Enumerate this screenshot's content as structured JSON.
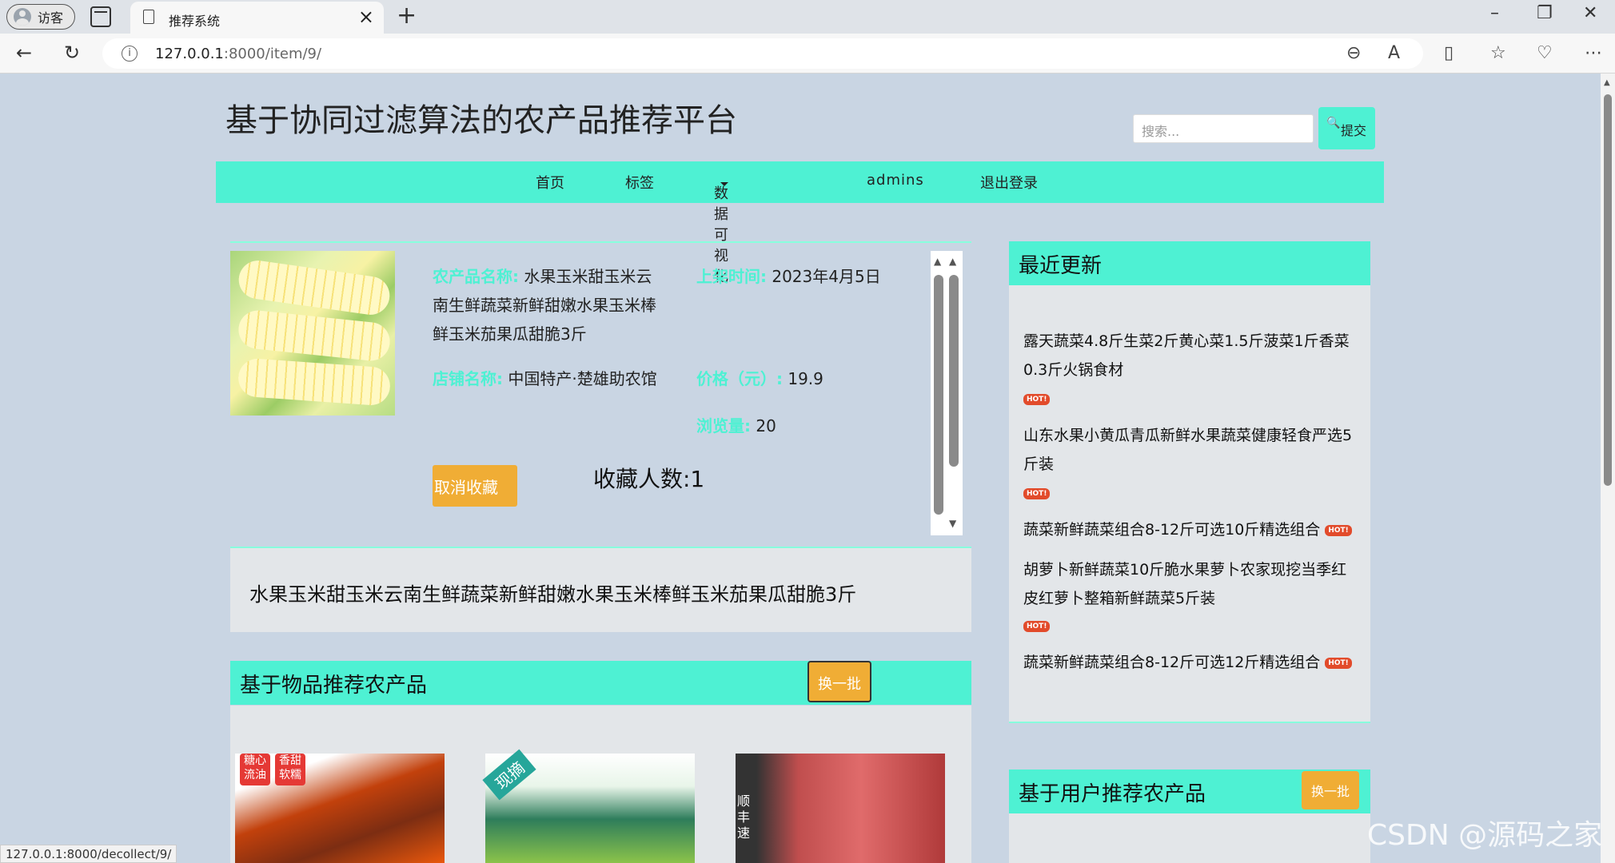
{
  "browser": {
    "profile_label": "访客",
    "tab_title": "推荐系统",
    "url_host": "127.0.0.1",
    "url_path": ":8000/item/9/",
    "status_url": "127.0.0.1:8000/decollect/9/"
  },
  "site": {
    "title": "基于协同过滤算法的农产品推荐平台",
    "search_placeholder": "搜索...",
    "submit_label": "提交"
  },
  "nav": {
    "items": [
      "首页",
      "标签",
      "数据可视化",
      "admins",
      "退出登录"
    ]
  },
  "product": {
    "name_label": "农产品名称:",
    "name": "水果玉米甜玉米云南生鲜蔬菜新鲜甜嫩水果玉米棒鲜玉米茄果瓜甜脆3斤",
    "date_label": "上架时间:",
    "date": "2023年4月5日",
    "shop_label": "店铺名称:",
    "shop": "中国特产·楚雄助农馆",
    "price_label": "价格（元）:",
    "price": "19.9",
    "views_label": "浏览量:",
    "views": "20",
    "unfavorite_label": "取消收藏",
    "favorite_count": "收藏人数:1",
    "description": "水果玉米甜玉米云南生鲜蔬菜新鲜甜嫩水果玉米棒鲜玉米茄果瓜甜脆3斤"
  },
  "item_recs": {
    "title": "基于物品推荐农产品",
    "refresh_label": "换一批",
    "image_captions": [
      "糖心流油",
      "香甜软糯",
      "现摘",
      "顺丰速"
    ]
  },
  "recent": {
    "title": "最近更新",
    "items": [
      "露天蔬菜4.8斤生菜2斤黄心菜1.5斤菠菜1斤香菜0.3斤火锅食材",
      "山东水果小黄瓜青瓜新鲜水果蔬菜健康轻食严选5斤装",
      "蔬菜新鲜蔬菜组合8-12斤可选10斤精选组合",
      "胡萝卜新鲜蔬菜10斤脆水果萝卜农家现挖当季红皮红萝卜整箱新鲜蔬菜5斤装",
      "蔬菜新鲜蔬菜组合8-12斤可选12斤精选组合"
    ],
    "hot_badge": "HOT!"
  },
  "user_recs": {
    "title": "基于用户推荐农产品",
    "refresh_label": "换一批"
  },
  "watermark": "CSDN @源码之家",
  "colors": {
    "accent": "#4ef1d3",
    "button": "#f0ad35",
    "background": "#c9d5e3"
  }
}
